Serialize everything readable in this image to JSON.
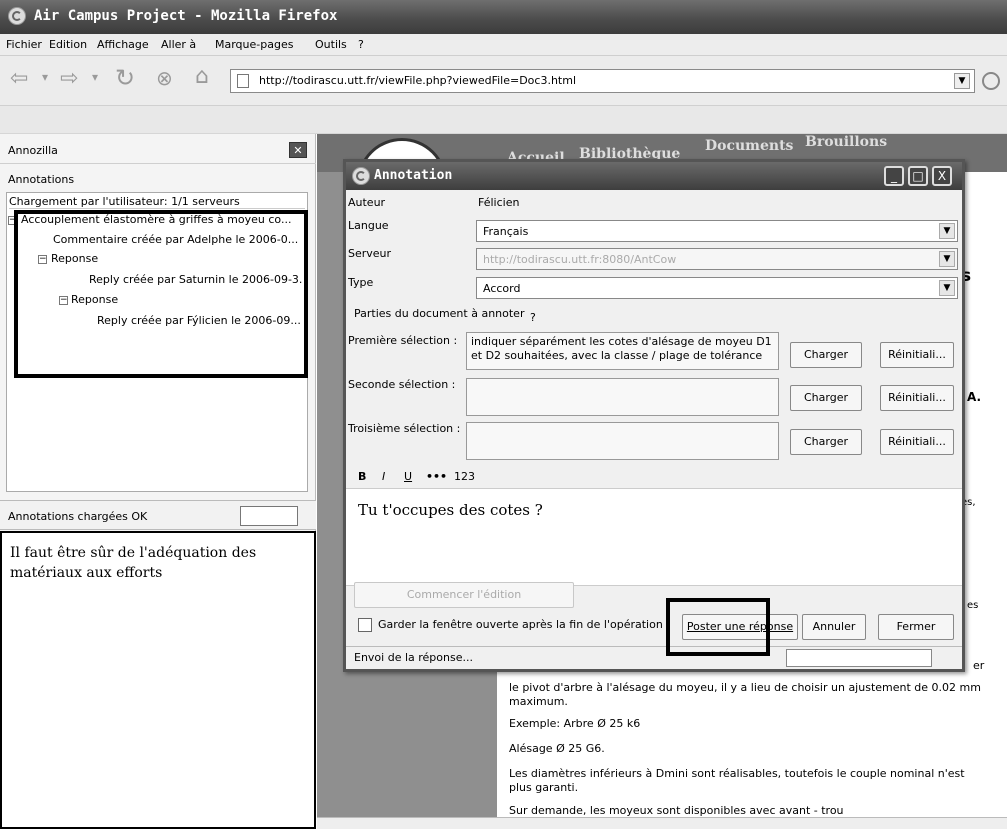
{
  "window": {
    "title": "Air Campus Project - Mozilla Firefox"
  },
  "menu": {
    "items": [
      "Fichier",
      "Edition",
      "Affichage",
      "Aller à",
      "Marque-pages",
      "Outils",
      "?"
    ]
  },
  "nav": {
    "url": "http://todirascu.utt.fr/viewFile.php?viewedFile=Doc3.html"
  },
  "sidebar": {
    "title": "Annozilla",
    "annotations_label": "Annotations",
    "tree_header": "Chargement par l'utilisateur: 1/1 serveurs",
    "tree": [
      "Accouplement élastomère à griffes à moyeu co...",
      "Commentaire créée par Adelphe le 2006-0...",
      "Reponse",
      "Reply créée par Saturnin le 2006-09-3...",
      "Reponse",
      "Reply créée par Fýlicien le 2006-09..."
    ],
    "tree_box_minus": "−",
    "status": "Annotations chargées OK",
    "note": "Il faut être sûr de l'adéquation des matériaux aux efforts"
  },
  "site": {
    "nav": [
      "Accueil",
      "Bibliothèque",
      "Documents",
      "Brouillons"
    ],
    "side_caps": [
      "s",
      "A.",
      "es,",
      "es",
      "er"
    ],
    "paragraphs": [
      "le pivot d'arbre à l'alésage du moyeu, il y a lieu de choisir un ajustement de 0.02 mm maximum.",
      "Exemple: Arbre Ø 25 k6",
      "Alésage Ø 25 G6.",
      "Les diamètres inférieurs à Dmini sont réalisables, toutefois le couple nominal n'est plus garanti.",
      "Sur demande, les moyeux sont disponibles avec avant - trou"
    ]
  },
  "dialog": {
    "title": "Annotation",
    "win_buttons": [
      "_",
      "□",
      "X"
    ],
    "labels": {
      "auteur": "Auteur",
      "langue": "Langue",
      "serveur": "Serveur",
      "type": "Type",
      "parties": "Parties du document à annoter",
      "parties_help": "?",
      "sel1": "Première sélection :",
      "sel2": "Seconde sélection :",
      "sel3": "Troisième sélection :"
    },
    "values": {
      "auteur": "Félicien",
      "langue": "Français",
      "serveur": "http://todirascu.utt.fr:8080/AntCow",
      "type": "Accord",
      "sel1": "indiquer séparément les cotes d'alésage de moyeu D1 et D2 souhaitées, avec la classe / plage de tolérance"
    },
    "buttons": {
      "charger": "Charger",
      "reinit": "Réinitiali...",
      "commencer": "Commencer l'édition",
      "poster": "Poster une réponse",
      "annuler": "Annuler",
      "fermer": "Fermer"
    },
    "format": [
      "B",
      "I",
      "U",
      "•••",
      "123"
    ],
    "editor_text": "Tu t'occupes des cotes ?",
    "keep_open": "Garder la fenêtre ouverte après la fin de l'opération",
    "status": "Envoi de la réponse..."
  }
}
